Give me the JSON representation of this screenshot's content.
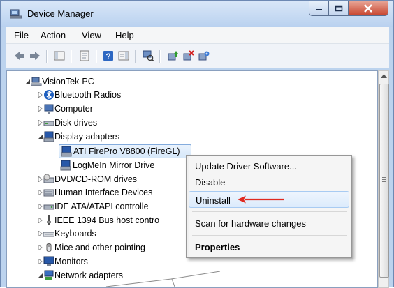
{
  "window": {
    "title": "Device Manager",
    "menu": [
      "File",
      "Action",
      "View",
      "Help"
    ],
    "toolbar_icons": [
      "back-arrow-icon",
      "forward-arrow-icon",
      "show-hide-console-tree-icon",
      "properties-icon",
      "help-icon",
      "action-pane-icon",
      "scan-hardware-changes-icon",
      "update-driver-icon",
      "uninstall-device-icon",
      "enable-device-icon"
    ]
  },
  "tree": {
    "root": "VisionTek-PC",
    "items": [
      {
        "label": "Bluetooth Radios",
        "icon": "bluetooth-icon"
      },
      {
        "label": "Computer",
        "icon": "computer-icon"
      },
      {
        "label": "Disk drives",
        "icon": "disk-drive-icon"
      },
      {
        "label": "Display adapters",
        "icon": "display-adapter-icon",
        "expanded": true
      },
      {
        "label": "ATI FirePro V8800 (FireGL)",
        "icon": "display-adapter-icon",
        "child": true,
        "selected": true
      },
      {
        "label": "LogMeIn Mirror Drive",
        "icon": "display-adapter-icon",
        "child": true
      },
      {
        "label": "DVD/CD-ROM drives",
        "icon": "dvd-drive-icon"
      },
      {
        "label": "Human Interface Devices",
        "icon": "hid-icon"
      },
      {
        "label": "IDE ATA/ATAPI controlle",
        "icon": "ide-controller-icon"
      },
      {
        "label": "IEEE 1394 Bus host contro",
        "icon": "ieee1394-icon"
      },
      {
        "label": "Keyboards",
        "icon": "keyboard-icon"
      },
      {
        "label": "Mice and other pointing",
        "icon": "mouse-icon"
      },
      {
        "label": "Monitors",
        "icon": "monitor-icon"
      },
      {
        "label": "Network adapters",
        "icon": "network-adapter-icon"
      }
    ]
  },
  "context_menu": {
    "update": "Update Driver Software...",
    "disable": "Disable",
    "uninstall": "Uninstall",
    "scan": "Scan for hardware changes",
    "properties": "Properties"
  },
  "colors": {
    "arrow": "#e02a20",
    "selection_border": "#84acdd",
    "titlebar": "#c9dcf3"
  }
}
